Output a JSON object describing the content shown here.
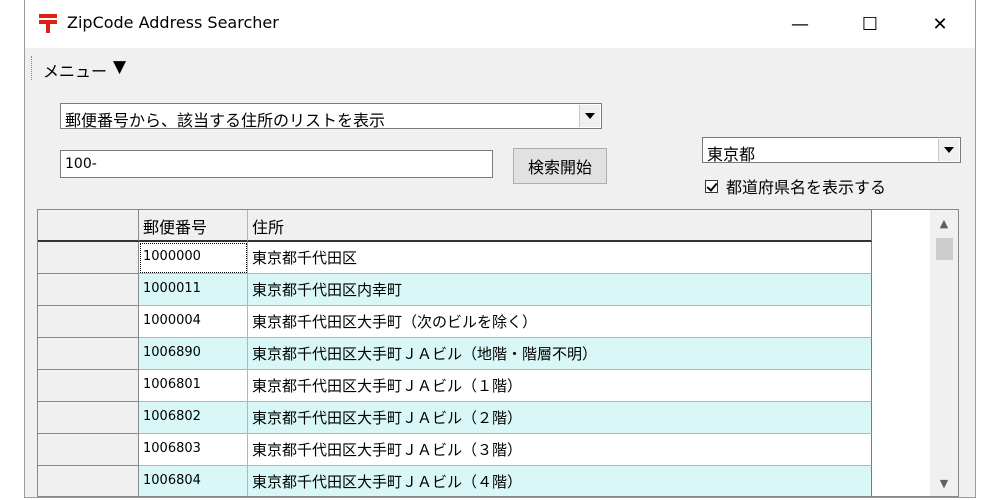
{
  "window": {
    "title": "ZipCode Address Searcher",
    "minimize": "—",
    "maximize": "☐",
    "close": "✕"
  },
  "menubar": {
    "menu_label": "メニュー",
    "menu_arrow": "▼"
  },
  "search": {
    "mode_selected": "郵便番号から、該当する住所のリストを表示",
    "query_value": "100-",
    "search_button": "検索開始",
    "prefecture_selected": "東京都",
    "show_prefecture_label": "都道府県名を表示する",
    "show_prefecture_checked": true
  },
  "table": {
    "columns": [
      "",
      "郵便番号",
      "住所"
    ],
    "rows": [
      {
        "zip": "1000000",
        "address": "東京都千代田区"
      },
      {
        "zip": "1000011",
        "address": "東京都千代田区内幸町"
      },
      {
        "zip": "1000004",
        "address": "東京都千代田区大手町（次のビルを除く）"
      },
      {
        "zip": "1006890",
        "address": "東京都千代田区大手町ＪＡビル（地階・階層不明）"
      },
      {
        "zip": "1006801",
        "address": "東京都千代田区大手町ＪＡビル（１階）"
      },
      {
        "zip": "1006802",
        "address": "東京都千代田区大手町ＪＡビル（２階）"
      },
      {
        "zip": "1006803",
        "address": "東京都千代田区大手町ＪＡビル（３階）"
      },
      {
        "zip": "1006804",
        "address": "東京都千代田区大手町ＪＡビル（４階）"
      }
    ]
  },
  "icons": {
    "app": "postal-mark-icon",
    "accent_color": "#e02010"
  }
}
